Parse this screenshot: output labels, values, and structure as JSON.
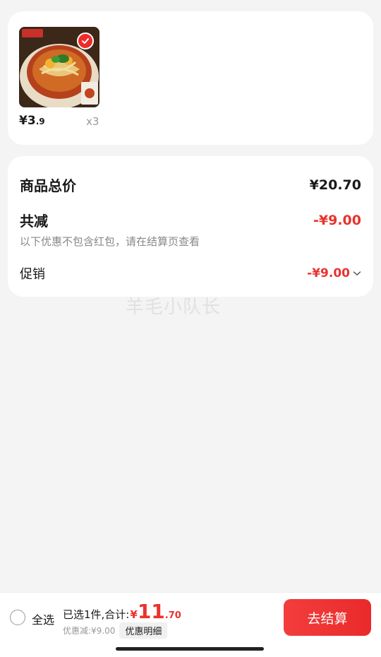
{
  "product": {
    "price_symbol": "¥",
    "price_int": "3",
    "price_dec": ".9",
    "quantity": "x3",
    "selected": true,
    "image_icon": "noodle-bowl-image",
    "image_brand_text": "素汤面"
  },
  "summary": {
    "total_label": "商品总价",
    "total_value": "¥20.70",
    "reduce_label": "共减",
    "reduce_value": "-¥9.00",
    "note": "以下优惠不包含红包，请在结算页查看",
    "promo_label": "促销",
    "promo_value": "-¥9.00",
    "promo_icon": "chevron-down-icon"
  },
  "watermark": "羊毛小队长",
  "bottom_bar": {
    "select_all_label": "全选",
    "selected_summary": "已选1件,合计:",
    "currency": "¥",
    "total_int": "11",
    "total_dec": ".70",
    "discount_text": "优惠减:¥9.00",
    "detail_button": "优惠明细",
    "checkout_button": "去结算"
  },
  "colors": {
    "accent_red": "#e8332e",
    "checkout_red": "#f33d3d",
    "background": "#f4f4f4"
  }
}
